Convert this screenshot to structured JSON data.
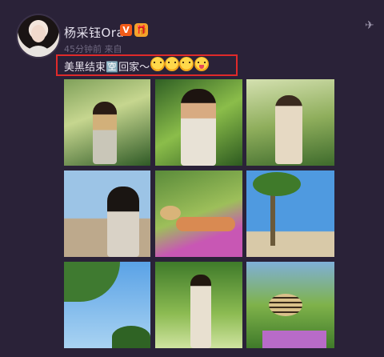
{
  "post": {
    "username": "杨采钰Ora",
    "verified_badge": "V",
    "level_badge": "🎁",
    "meta": "45分钟前 来自",
    "text": "美黑结束🈳回家～",
    "emoji": [
      "blossom-smile-emoji",
      "blossom-smile-emoji",
      "blossom-smile-emoji",
      "tongue-out-emoji"
    ],
    "more_icon": "✈"
  },
  "colors": {
    "background": "#2a2238",
    "highlight_border": "#e02a2a",
    "verified": "#f25c19"
  },
  "photos": [
    {
      "name": "photo-1"
    },
    {
      "name": "photo-2"
    },
    {
      "name": "photo-3"
    },
    {
      "name": "photo-4"
    },
    {
      "name": "photo-5"
    },
    {
      "name": "photo-6"
    },
    {
      "name": "photo-7"
    },
    {
      "name": "photo-8"
    },
    {
      "name": "photo-9"
    }
  ]
}
